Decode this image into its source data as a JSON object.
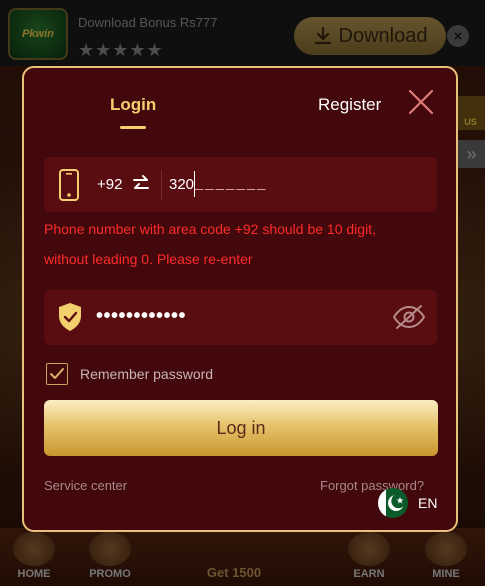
{
  "banner": {
    "logo_text": "Pkwin",
    "bonus_text": "Download Bonus Rs777",
    "stars": "★★★★★",
    "download_label": "Download",
    "close_glyph": "×"
  },
  "side": {
    "bonus_label": "US",
    "arrow_glyph": "»"
  },
  "bottom_nav": {
    "home": "HOME",
    "promo": "PROMO",
    "center": "Get 1500",
    "earn": "EARN",
    "mine": "MINE"
  },
  "modal": {
    "tabs": {
      "login": "Login",
      "register": "Register"
    },
    "phone": {
      "country_code": "+92",
      "value": "320",
      "mask": "_______"
    },
    "error": "Phone number with area code +92 should be 10 digit, without leading 0. Please re-enter",
    "password": {
      "masked_value": "••••••••••••"
    },
    "remember": {
      "label": "Remember password",
      "checked": true
    },
    "login_button": "Log in",
    "service_center": "Service center",
    "forgot_password": "Forgot password?",
    "language": "EN"
  },
  "colors": {
    "accent": "#f4cf6e",
    "modal_bg": "#42080b",
    "field_bg": "#5a0d10",
    "error": "#ff2b2b",
    "border": "#e8c27a"
  },
  "icons": [
    "phone-icon",
    "swap-icon",
    "shield-icon",
    "eye-off-icon",
    "check-icon",
    "close-icon",
    "pakistan-flag-icon",
    "download-icon"
  ]
}
